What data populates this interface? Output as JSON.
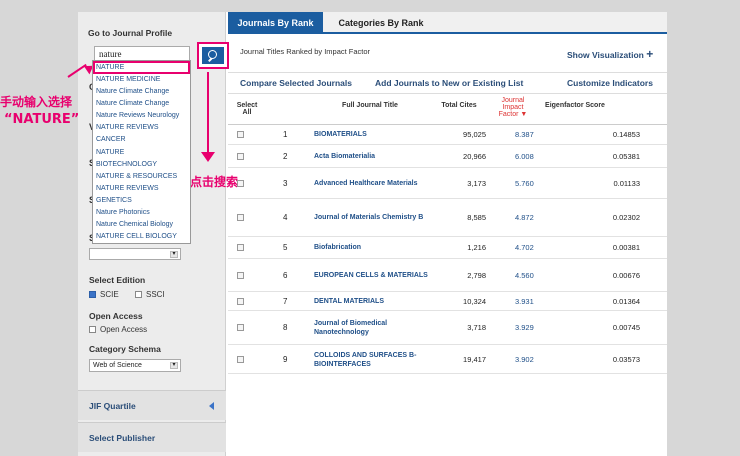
{
  "sidebar": {
    "title": "Go to Journal Profile",
    "search_value": "nature",
    "suggestions": [
      "NATURE",
      "NATURE MEDICINE",
      "Nature Climate Change",
      "Nature Climate Change",
      "Nature Reviews Neurology",
      "NATURE REVIEWS",
      "CANCER",
      "NATURE",
      "BIOTECHNOLOGY",
      "NATURE & RESOURCES",
      "NATURE REVIEWS",
      "GENETICS",
      "Nature Photonics",
      "Nature Chemical Biology",
      "NATURE CELL BIOLOGY"
    ],
    "peek": [
      "C",
      "V",
      "S",
      "S",
      "S",
      "S"
    ],
    "select_edition_label": "Select Edition",
    "edition_scie": "SCIE",
    "edition_ssci": "SSCI",
    "open_access_label": "Open Access",
    "open_access_option": "Open Access",
    "category_schema_label": "Category Schema",
    "category_schema_value": "Web of Science",
    "jif_quartile": "JIF Quartile",
    "select_publisher": "Select Publisher"
  },
  "annotations": {
    "left_line1": "手动输入选择",
    "left_line2": "“NATURE”",
    "search_hint": "点击搜索"
  },
  "tabs": {
    "journals_by_rank": "Journals By Rank",
    "categories_by_rank": "Categories By Rank"
  },
  "subheader": {
    "ranked_text": "Journal Titles Ranked by Impact Factor",
    "show_visualization": "Show Visualization",
    "plus": "+"
  },
  "actions": {
    "compare": "Compare Selected Journals",
    "add": "Add Journals to New or Existing List",
    "customize": "Customize Indicators"
  },
  "table": {
    "headers": {
      "select_all": "Select All",
      "title": "Full Journal Title",
      "cites": "Total Cites",
      "jif": "Journal Impact Factor",
      "jif_sort": "▼",
      "eigen": "Eigenfactor Score"
    },
    "rows": [
      {
        "rank": "1",
        "title": "BIOMATERIALS",
        "cites": "95,025",
        "jif": "8.387",
        "eigen": "0.14853"
      },
      {
        "rank": "2",
        "title": "Acta Biomaterialia",
        "cites": "20,966",
        "jif": "6.008",
        "eigen": "0.05381"
      },
      {
        "rank": "3",
        "title": "Advanced Healthcare Materials",
        "cites": "3,173",
        "jif": "5.760",
        "eigen": "0.01133"
      },
      {
        "rank": "4",
        "title": "Journal of Materials Chemistry B",
        "cites": "8,585",
        "jif": "4.872",
        "eigen": "0.02302"
      },
      {
        "rank": "5",
        "title": "Biofabrication",
        "cites": "1,216",
        "jif": "4.702",
        "eigen": "0.00381"
      },
      {
        "rank": "6",
        "title": "EUROPEAN CELLS & MATERIALS",
        "cites": "2,798",
        "jif": "4.560",
        "eigen": "0.00676"
      },
      {
        "rank": "7",
        "title": "DENTAL MATERIALS",
        "cites": "10,324",
        "jif": "3.931",
        "eigen": "0.01364"
      },
      {
        "rank": "8",
        "title": "Journal of Biomedical Nanotechnology",
        "cites": "3,718",
        "jif": "3.929",
        "eigen": "0.00745"
      },
      {
        "rank": "9",
        "title": "COLLOIDS AND SURFACES B-BIOINTERFACES",
        "cites": "19,417",
        "jif": "3.902",
        "eigen": "0.03573"
      }
    ]
  },
  "colors": {
    "accent": "#1b5da0",
    "annotation": "#e8006e",
    "link": "#1f4f88"
  }
}
